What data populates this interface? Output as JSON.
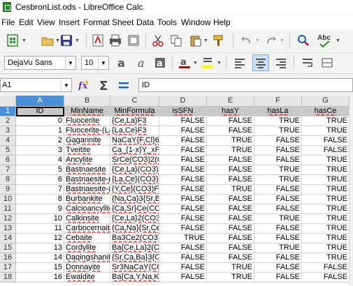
{
  "window": {
    "title": "CesbronList.ods - LibreOffice Calc"
  },
  "menu": [
    "File",
    "Edit",
    "View",
    "Insert",
    "Format",
    "Sheet",
    "Data",
    "Tools",
    "Window",
    "Help"
  ],
  "toolbar1": {
    "icons": [
      "new-icon",
      "open-icon",
      "save-icon",
      "export-pdf-icon",
      "print-icon",
      "print-preview-icon",
      "cut-icon",
      "copy-icon",
      "paste-icon",
      "clone-formatting-icon",
      "undo-icon",
      "redo-icon",
      "find-replace-icon",
      "spelling-icon"
    ],
    "colors": {
      "new": "#2e8b2e",
      "pdf": "#cc1f1f",
      "save": "#3a3a8a",
      "cut": "#c02020",
      "find": "#1f5fbf"
    }
  },
  "toolbar2": {
    "font_name": "DejaVu Sans",
    "font_size": "10",
    "font_color": "#c00000",
    "highlight_color": "#ffff00"
  },
  "formula_bar": {
    "cell_ref": "A1",
    "content": "ID"
  },
  "sheet": {
    "columns": [
      "A",
      "B",
      "C",
      "D",
      "E",
      "F",
      "G"
    ],
    "selected_column": "A",
    "selected_row": "1",
    "header_row": [
      "ID",
      "MinName",
      "MinFormula",
      "isSFN",
      "hasY",
      "hasLa",
      "hasCe"
    ],
    "rows": [
      [
        "0",
        "Fluocerite",
        "{Ce,La}F3",
        "FALSE",
        "FALSE",
        "TRUE",
        "TRUE"
      ],
      [
        "1",
        "Fluocerite-(La)",
        "{La,Ce}F3",
        "FALSE",
        "FALSE",
        "TRUE",
        "TRUE"
      ],
      [
        "2",
        "Gagarinite",
        "NaCaY{F,Cl}6",
        "FALSE",
        "TRUE",
        "FALSE",
        "FALSE"
      ],
      [
        "3",
        "Tveitite",
        "Ca_{1-x}Y_xF",
        "FALSE",
        "TRUE",
        "FALSE",
        "FALSE"
      ],
      [
        "4",
        "Ancylite",
        "SrCe(CO3)2(OH)",
        "FALSE",
        "FALSE",
        "FALSE",
        "TRUE"
      ],
      [
        "5",
        "Bastnaesite",
        "{Ce,La}(CO3)F",
        "FALSE",
        "FALSE",
        "TRUE",
        "TRUE"
      ],
      [
        "6",
        "Bastnaesite-(La)",
        "{La,Ce}(CO3)F",
        "FALSE",
        "FALSE",
        "TRUE",
        "TRUE"
      ],
      [
        "7",
        "Bastnaesite-(Y)",
        "{Y,Ce}(CO3)F",
        "FALSE",
        "TRUE",
        "FALSE",
        "TRUE"
      ],
      [
        "8",
        "Burbankite",
        "{Na,Ca}3{Sr,Ba}",
        "FALSE",
        "FALSE",
        "FALSE",
        "TRUE"
      ],
      [
        "9",
        "Calcioancylite",
        "{Ca,Sr}Ce(CO3)",
        "FALSE",
        "FALSE",
        "FALSE",
        "TRUE"
      ],
      [
        "10",
        "Calkinsite",
        "{Ce,La}2(CO3)3",
        "FALSE",
        "FALSE",
        "TRUE",
        "TRUE"
      ],
      [
        "11",
        "Carbocernaite",
        "{Ca,Na}{Sr,Ce}",
        "FALSE",
        "FALSE",
        "FALSE",
        "TRUE"
      ],
      [
        "12",
        "Cebaite",
        "Ba3Ce2(CO3)5F2",
        "TRUE",
        "FALSE",
        "FALSE",
        "TRUE"
      ],
      [
        "13",
        "Cordylite",
        "Ba{Ce,La}2(CO3)",
        "FALSE",
        "FALSE",
        "TRUE",
        "TRUE"
      ],
      [
        "14",
        "Daqingshanite",
        "{Sr,Ca,Ba}3{Ce}",
        "FALSE",
        "FALSE",
        "FALSE",
        "TRUE"
      ],
      [
        "15",
        "Donnayite",
        "Sr3NaCaY(CO3)6",
        "FALSE",
        "TRUE",
        "FALSE",
        "FALSE"
      ],
      [
        "16",
        "Ewaldite",
        "Ba{Ca,Y,Na,K}",
        "FALSE",
        "TRUE",
        "FALSE",
        "FALSE"
      ]
    ]
  }
}
